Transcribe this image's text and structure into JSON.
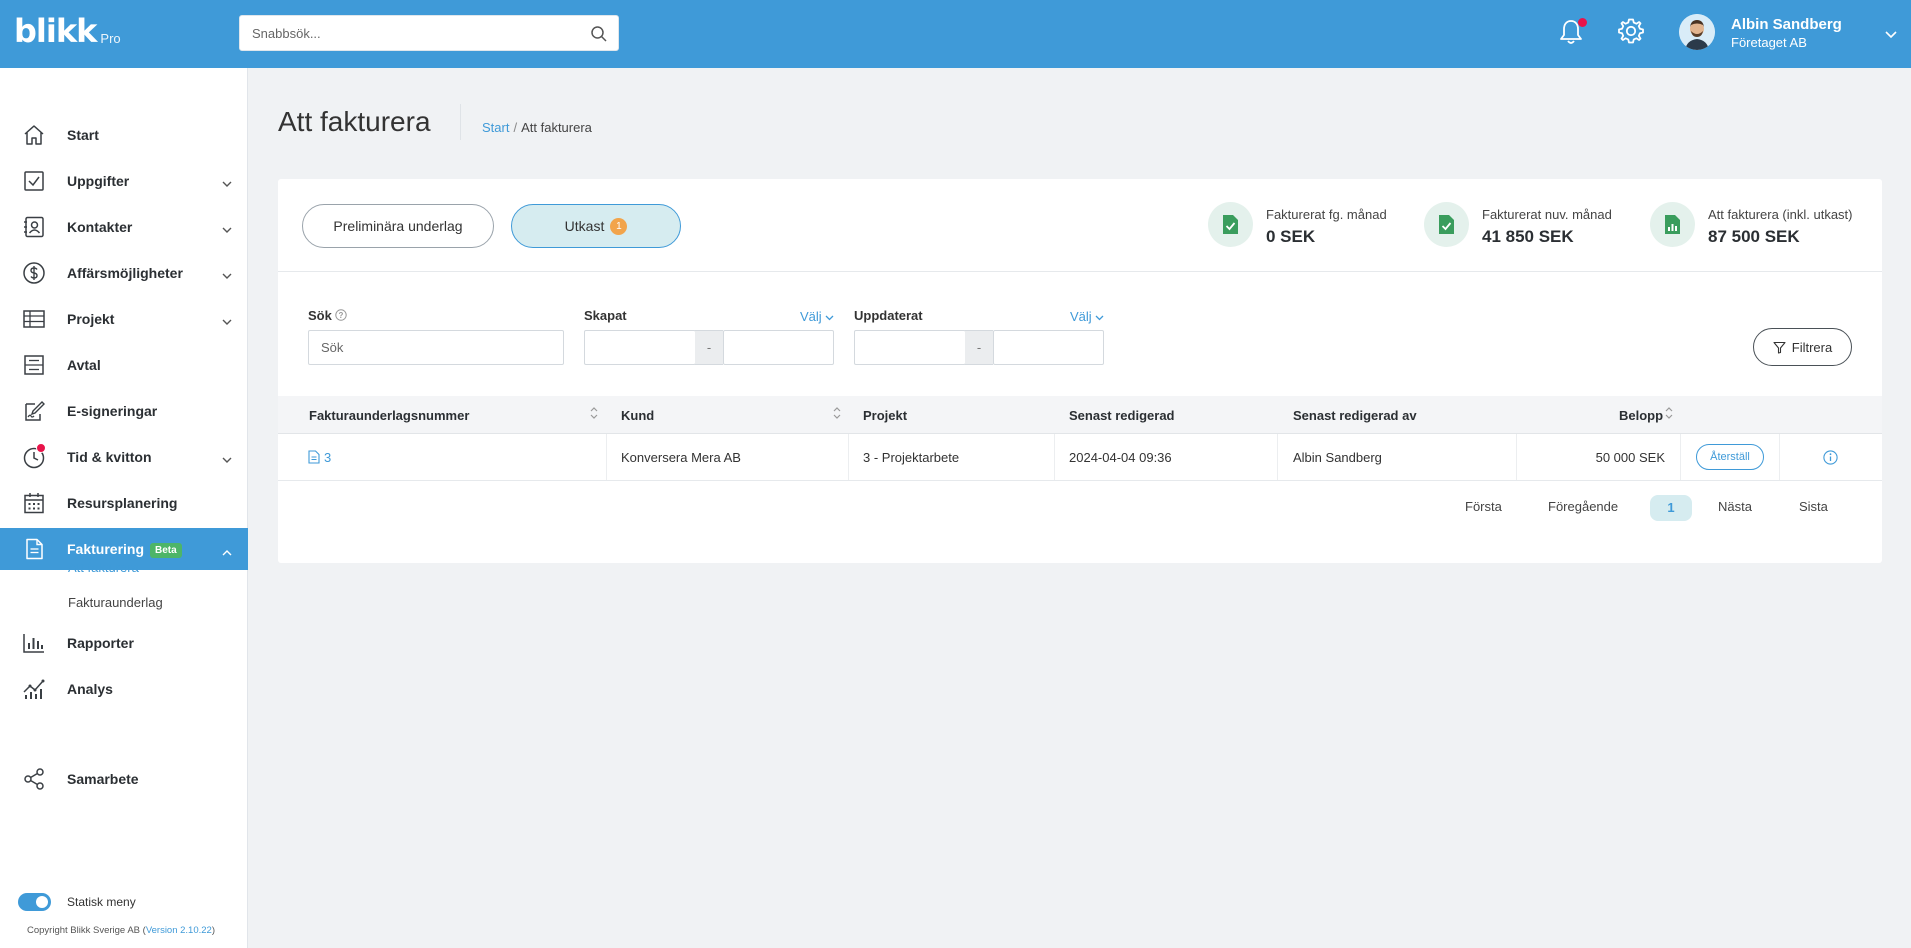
{
  "brand": {
    "name": "blikk",
    "edition": "Pro"
  },
  "topbar": {
    "search_placeholder": "Snabbsök...",
    "user_name": "Albin Sandberg",
    "user_company": "Företaget AB"
  },
  "sidebar": {
    "items": [
      {
        "label": "Start",
        "icon": "home-icon"
      },
      {
        "label": "Uppgifter",
        "icon": "checkbox-icon"
      },
      {
        "label": "Kontakter",
        "icon": "contacts-icon"
      },
      {
        "label": "Affärsmöjligheter",
        "icon": "dollar-icon"
      },
      {
        "label": "Projekt",
        "icon": "table-icon"
      },
      {
        "label": "Avtal",
        "icon": "contract-icon"
      },
      {
        "label": "E-signeringar",
        "icon": "signature-icon"
      },
      {
        "label": "Tid & kvitton",
        "icon": "clock-icon"
      },
      {
        "label": "Resursplanering",
        "icon": "calendar-icon"
      },
      {
        "label": "Fakturering",
        "icon": "invoice-icon",
        "badge": "Beta",
        "active": true
      },
      {
        "label": "Rapporter",
        "icon": "bar-chart-icon"
      },
      {
        "label": "Analys",
        "icon": "analytics-icon"
      },
      {
        "label": "Samarbete",
        "icon": "share-icon"
      }
    ],
    "sub_items": [
      "Att fakturera",
      "Fakturaunderlag"
    ],
    "toggle_label": "Statisk meny",
    "copyright": "Copyright Blikk Sverige AB",
    "version": "Version 2.10.22"
  },
  "page": {
    "title": "Att fakturera",
    "breadcrumb": [
      "Start",
      "Att fakturera"
    ]
  },
  "tabs": [
    {
      "label": "Preliminära underlag"
    },
    {
      "label": "Utkast",
      "count": "1"
    }
  ],
  "stats": [
    {
      "label": "Fakturerat fg. månad",
      "value": "0 SEK"
    },
    {
      "label": "Fakturerat nuv. månad",
      "value": "41 850 SEK"
    },
    {
      "label": "Att fakturera (inkl. utkast)",
      "value": "87 500 SEK"
    }
  ],
  "filters": {
    "search_label": "Sök",
    "search_placeholder": "Sök",
    "created_label": "Skapat",
    "updated_label": "Uppdaterat",
    "choose_label": "Välj",
    "range_dash": "-",
    "filter_button": "Filtrera"
  },
  "table": {
    "columns": [
      "Fakturaunderlagsnummer",
      "Kund",
      "Projekt",
      "Senast redigerad",
      "Senast redigerad av",
      "Belopp"
    ],
    "rows": [
      {
        "number": "3",
        "customer": "Konversera Mera AB",
        "project": "3 - Projektarbete",
        "edited": "2024-04-04 09:36",
        "edited_by": "Albin Sandberg",
        "amount": "50 000 SEK",
        "action": "Återställ"
      }
    ]
  },
  "pagination": {
    "first": "Första",
    "prev": "Föregående",
    "current": "1",
    "next": "Nästa",
    "last": "Sista"
  },
  "colors": {
    "primary": "#3f9ad8",
    "beta_badge": "#4db568",
    "notification": "#e8134a",
    "tab_badge": "#f2a44b",
    "stat_icon_bg": "#e4f1ec",
    "stat_icon": "#3a9d5d"
  }
}
